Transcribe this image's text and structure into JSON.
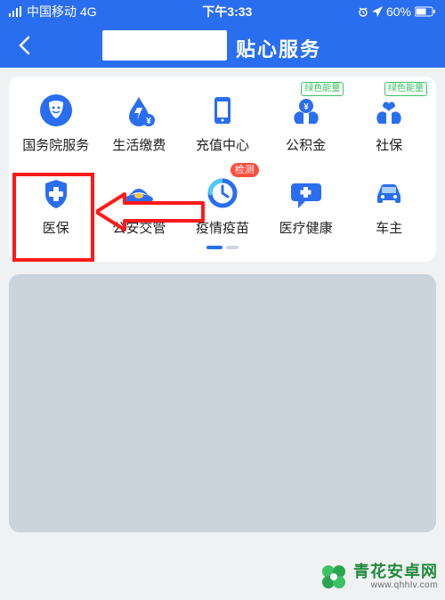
{
  "status": {
    "carrier": "中国移动",
    "network": "4G",
    "time": "下午3:33",
    "battery": "60%"
  },
  "nav": {
    "title": "贴心服务"
  },
  "badges": {
    "green_energy": "绿色能量",
    "detect": "检测"
  },
  "grid": {
    "items": [
      {
        "label": "国务院服务"
      },
      {
        "label": "生活缴费"
      },
      {
        "label": "充值中心"
      },
      {
        "label": "公积金"
      },
      {
        "label": "社保"
      },
      {
        "label": "医保"
      },
      {
        "label": "公安交管"
      },
      {
        "label": "疫情疫苗"
      },
      {
        "label": "医疗健康"
      },
      {
        "label": "车主"
      }
    ]
  },
  "watermark": {
    "title": "青花安卓网",
    "sub": "www.qhhlv.com"
  },
  "colors": {
    "primary": "#2a6ef0",
    "accent_red": "#ff4d3d",
    "accent_green": "#3cc265"
  }
}
